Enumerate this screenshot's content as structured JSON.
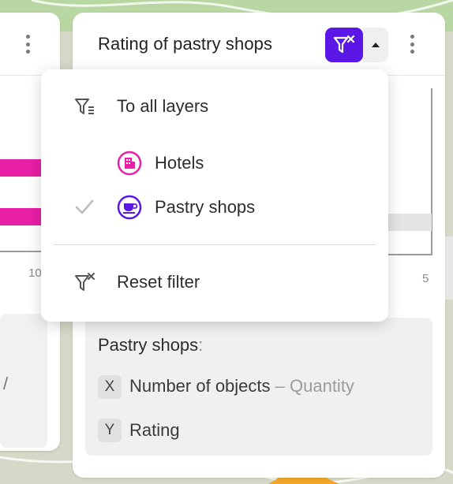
{
  "colors": {
    "accent": "#5b17e6",
    "hotels": "#e820a6",
    "pastry": "#5b17e6"
  },
  "left_card": {
    "tick_label": "10",
    "legend_fragment": "/"
  },
  "main_card": {
    "title": "Rating of pastry shops",
    "filter_icon": "filter-reset-icon",
    "caret_icon": "caret-up-icon",
    "tick_label": "5",
    "legend": {
      "title": "Pastry shops",
      "colon": ":",
      "x_badge": "X",
      "x_label": "Number of objects",
      "x_sep": " – ",
      "x_agg": "Quantity",
      "y_badge": "Y",
      "y_label": "Rating"
    }
  },
  "dropdown": {
    "all_layers": {
      "label": "To all layers",
      "icon": "filter-list-icon"
    },
    "layers": [
      {
        "label": "Hotels",
        "icon": "hotel-icon",
        "checked": false
      },
      {
        "label": "Pastry shops",
        "icon": "cup-icon",
        "checked": true
      }
    ],
    "reset": {
      "label": "Reset filter",
      "icon": "filter-reset-icon"
    }
  }
}
